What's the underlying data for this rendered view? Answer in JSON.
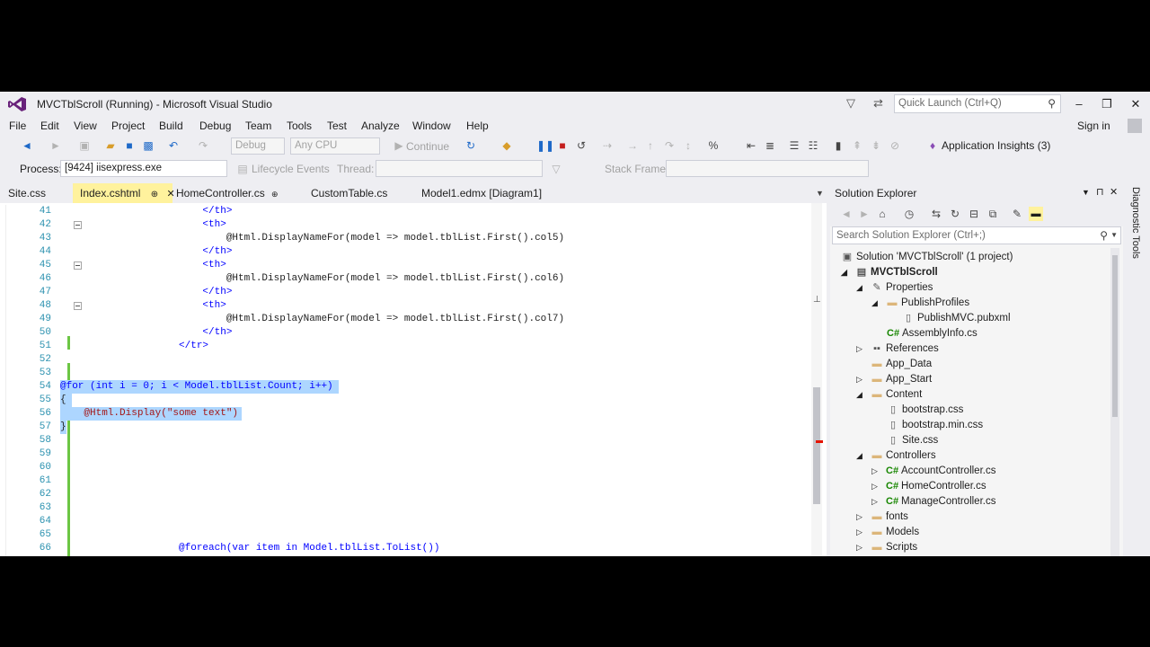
{
  "window": {
    "title": "MVCTblScroll (Running) - Microsoft Visual Studio",
    "quick_launch_placeholder": "Quick Launch (Ctrl+Q)",
    "sign_in": "Sign in"
  },
  "menu": [
    "File",
    "Edit",
    "View",
    "Project",
    "Build",
    "Debug",
    "Team",
    "Tools",
    "Test",
    "Analyze",
    "Window",
    "Help"
  ],
  "toolbar": {
    "config": "Debug",
    "platform": "Any CPU",
    "continue_label": "Continue",
    "app_insights": "Application Insights (3)"
  },
  "debug_location": {
    "process_label": "Process:",
    "process_value": "[9424] iisexpress.exe",
    "lifecycle_label": "Lifecycle Events",
    "thread_label": "Thread:",
    "stack_frame_label": "Stack Frame:"
  },
  "tabs": [
    {
      "label": "Site.css"
    },
    {
      "label": "Index.cshtml",
      "pin": "⊕",
      "close": "✕"
    },
    {
      "label": "HomeController.cs",
      "pin": "⊕"
    },
    {
      "label": "CustomTable.cs"
    },
    {
      "label": "Model1.edmx [Diagram1]"
    }
  ],
  "editor_lines": [
    {
      "n": "41",
      "text": "                        </th>"
    },
    {
      "n": "42",
      "text": "                        <th>"
    },
    {
      "n": "43",
      "text": "                            @Html.DisplayNameFor(model => model.tblList.First().col5)"
    },
    {
      "n": "44",
      "text": "                        </th>"
    },
    {
      "n": "45",
      "text": "                        <th>"
    },
    {
      "n": "46",
      "text": "                            @Html.DisplayNameFor(model => model.tblList.First().col6)"
    },
    {
      "n": "47",
      "text": "                        </th>"
    },
    {
      "n": "48",
      "text": "                        <th>"
    },
    {
      "n": "49",
      "text": "                            @Html.DisplayNameFor(model => model.tblList.First().col7)"
    },
    {
      "n": "50",
      "text": "                        </th>"
    },
    {
      "n": "51",
      "text": "                    </tr>"
    },
    {
      "n": "52",
      "text": ""
    },
    {
      "n": "53",
      "text": ""
    },
    {
      "n": "54",
      "text": "@for (int i = 0; i < Model.tblList.Count; i++)"
    },
    {
      "n": "55",
      "text": "{"
    },
    {
      "n": "56",
      "text": "    @Html.Display(\"some text\")"
    },
    {
      "n": "57",
      "text": "}"
    },
    {
      "n": "58",
      "text": ""
    },
    {
      "n": "59",
      "text": ""
    },
    {
      "n": "60",
      "text": ""
    },
    {
      "n": "61",
      "text": ""
    },
    {
      "n": "62",
      "text": ""
    },
    {
      "n": "63",
      "text": ""
    },
    {
      "n": "64",
      "text": ""
    },
    {
      "n": "65",
      "text": ""
    },
    {
      "n": "66",
      "text": "                    @foreach(var item in Model.tblList.ToList())"
    }
  ],
  "solution_explorer": {
    "title": "Solution Explorer",
    "search_placeholder": "Search Solution Explorer (Ctrl+;)",
    "items": [
      {
        "label": "Solution 'MVCTblScroll' (1 project)",
        "icon": "solution-icon"
      },
      {
        "label": "MVCTblScroll",
        "icon": "project-icon",
        "bold": true
      },
      {
        "label": "Properties",
        "icon": "wrench-icon"
      },
      {
        "label": "PublishProfiles",
        "icon": "folder-icon"
      },
      {
        "label": "PublishMVC.pubxml",
        "icon": "file-icon"
      },
      {
        "label": "AssemblyInfo.cs",
        "icon": "csharp-icon"
      },
      {
        "label": "References",
        "icon": "references-icon"
      },
      {
        "label": "App_Data",
        "icon": "folder-icon"
      },
      {
        "label": "App_Start",
        "icon": "folder-icon"
      },
      {
        "label": "Content",
        "icon": "folder-icon"
      },
      {
        "label": "bootstrap.css",
        "icon": "file-icon"
      },
      {
        "label": "bootstrap.min.css",
        "icon": "file-icon"
      },
      {
        "label": "Site.css",
        "icon": "file-icon"
      },
      {
        "label": "Controllers",
        "icon": "folder-icon"
      },
      {
        "label": "AccountController.cs",
        "icon": "csharp-icon"
      },
      {
        "label": "HomeController.cs",
        "icon": "csharp-icon"
      },
      {
        "label": "ManageController.cs",
        "icon": "csharp-icon"
      },
      {
        "label": "fonts",
        "icon": "folder-icon"
      },
      {
        "label": "Models",
        "icon": "folder-icon"
      },
      {
        "label": "Scripts",
        "icon": "folder-icon"
      }
    ]
  },
  "side_panel": {
    "label": "Diagnostic Tools"
  },
  "colors": {
    "chrome": "#eeeef2",
    "active_tab": "#fff29d",
    "selection": "#add6ff",
    "keyword": "#0000ff",
    "string": "#a31515",
    "line_number": "#2b91af"
  }
}
